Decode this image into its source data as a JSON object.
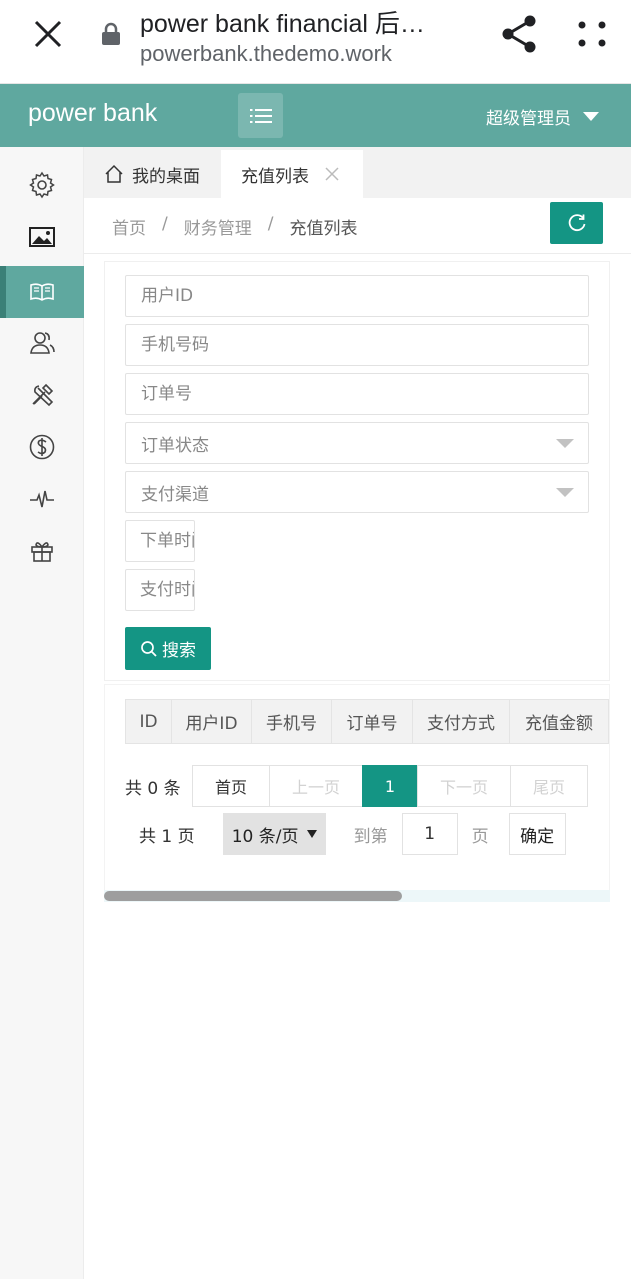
{
  "browser": {
    "title": "power bank financial 后…",
    "url": "powerbank.thedemo.work"
  },
  "header": {
    "brand": "power bank",
    "user": "超级管理员"
  },
  "sidebar": {
    "items": [
      {
        "icon": "gear-icon",
        "active": false
      },
      {
        "icon": "image-icon",
        "active": false
      },
      {
        "icon": "book-icon",
        "active": true
      },
      {
        "icon": "users-icon",
        "active": false
      },
      {
        "icon": "tools-icon",
        "active": false
      },
      {
        "icon": "dollar-icon",
        "active": false
      },
      {
        "icon": "pulse-icon",
        "active": false
      },
      {
        "icon": "gift-icon",
        "active": false
      }
    ]
  },
  "tabs": {
    "home": "我的桌面",
    "current": "充值列表"
  },
  "breadcrumb": {
    "items": [
      "首页",
      "财务管理",
      "充值列表"
    ],
    "separator": "/"
  },
  "form": {
    "user_id_placeholder": "用户ID",
    "phone_placeholder": "手机号码",
    "order_no_placeholder": "订单号",
    "order_status": "订单状态",
    "pay_channel": "支付渠道",
    "order_time_placeholder": "下单时间",
    "pay_time_placeholder": "支付时间",
    "search_label": "搜索"
  },
  "table": {
    "columns": [
      "ID",
      "用户ID",
      "手机号",
      "订单号",
      "支付方式",
      "充值金额"
    ]
  },
  "pagination": {
    "total": "共 0 条",
    "first": "首页",
    "prev": "上一页",
    "current": "1",
    "next": "下一页",
    "last": "尾页",
    "pages": "共 1 页",
    "limit": "10 条/页",
    "goto_label": "到第",
    "goto_value": "1",
    "page_unit": "页",
    "confirm": "确定"
  },
  "colors": {
    "header": "#5fa89f",
    "primary": "#149584"
  }
}
